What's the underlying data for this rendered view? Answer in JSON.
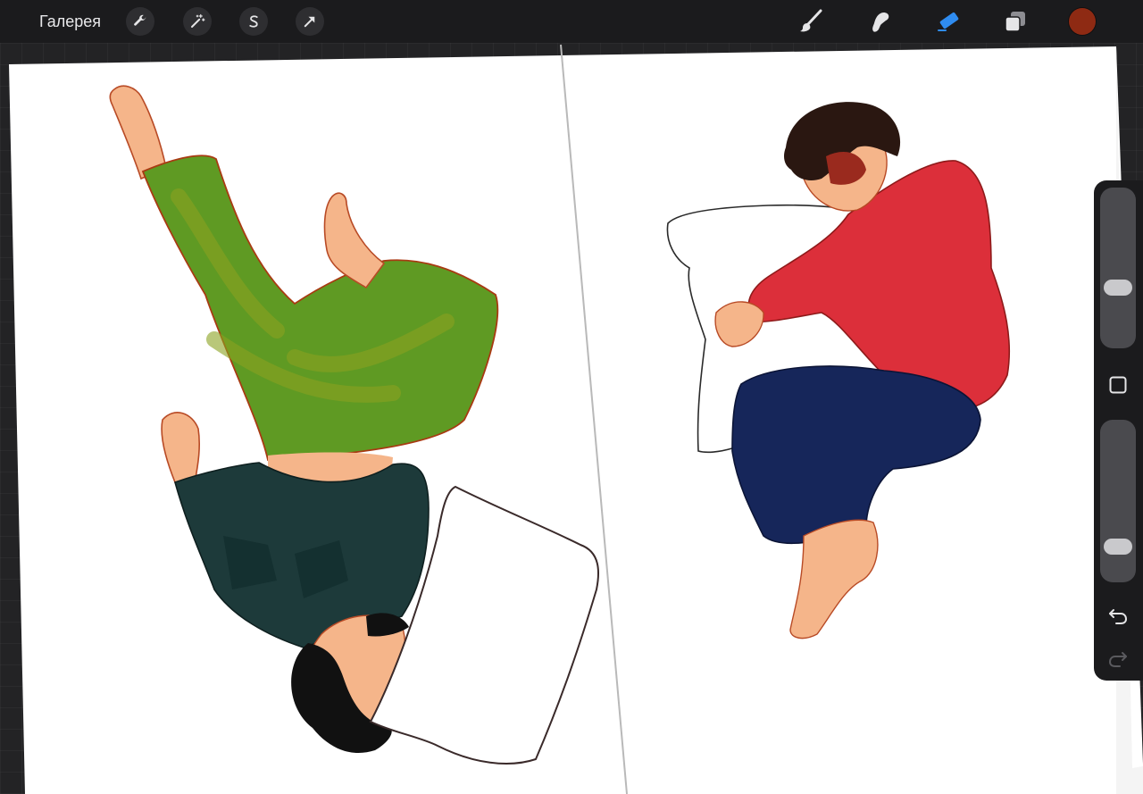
{
  "topbar": {
    "gallery_label": "Галерея",
    "left_tools": [
      {
        "icon": "wrench-icon",
        "name": "actions-button"
      },
      {
        "icon": "magic-wand-icon",
        "name": "adjustments-button"
      },
      {
        "icon": "selection-s-icon",
        "name": "selection-button"
      },
      {
        "icon": "arrow-cursor-icon",
        "name": "transform-button"
      }
    ],
    "right_tools": [
      {
        "icon": "brush-icon",
        "name": "brush-tool-button",
        "active": false
      },
      {
        "icon": "smudge-icon",
        "name": "smudge-tool-button",
        "active": false
      },
      {
        "icon": "eraser-icon",
        "name": "eraser-tool-button",
        "active": true
      },
      {
        "icon": "layers-icon",
        "name": "layers-button",
        "active": false
      }
    ],
    "current_color": "#8e2a13",
    "active_tool_color": "#2f8cf0"
  },
  "sidebar": {
    "brush_size": 0.24,
    "opacity": 0.24,
    "modify_icon": "square-modify-icon",
    "undo_icon": "undo-arrow-icon",
    "redo_icon": "redo-arrow-icon"
  },
  "canvas": {
    "left_figure": {
      "pants_color": "#5f9a23",
      "shirt_color": "#1d3a3a",
      "skin_color": "#f5b58a",
      "hair_color": "#111111"
    },
    "right_figure": {
      "hoodie_color": "#dc2f3a",
      "pants_color": "#16265a",
      "skin_color": "#f5b58a",
      "hair_color": "#2a1711"
    }
  }
}
